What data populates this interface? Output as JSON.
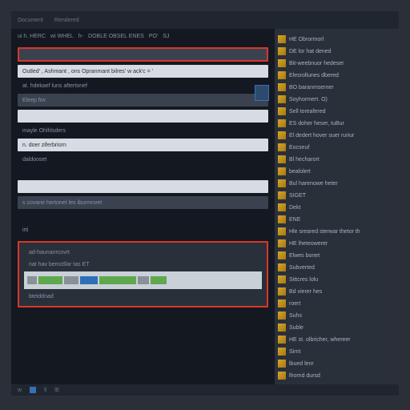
{
  "titlebar": {
    "items": [
      "Document",
      "Rendered"
    ]
  },
  "toolbar": [
    "ui h. HERC",
    "wi WHEL",
    "h-",
    "DOBLE OBSEL ENES",
    "PO'",
    "SJ"
  ],
  "rows": [
    "",
    "Outled' , Ashmant , ons Opranmant bilres' w ack'c  = '",
    "at. hdekaef luns aftertonef",
    "Eleep fov",
    "",
    "mayle Ohlhlsders",
    "n. doer ziferbriorn",
    "daldooset",
    "",
    "",
    "s covane hertonet les iburmnvet",
    "",
    "irti"
  ],
  "section": [
    "ad-haunanrcovrt",
    "nat hav bemctllar tas ET",
    "bteiddnad"
  ],
  "side": [
    "HE Obrormorl",
    "DE lor hat dened",
    "Bit-weebnuor hedeser",
    "Elesrollunes dbered",
    "BO baranmserner",
    "Soyhormert. O)",
    "Sell toreafered",
    "ES doher heser, tuBur",
    "El dedert hover suer ruriur",
    "Eocseuf",
    "Bl hecharort",
    "bealolert",
    "Bul harenowe heter",
    "SIGET",
    "Dekt",
    "ENE",
    "Hle sreared sterwar thetor th",
    "HE lheteowerer",
    "Elwes bonet",
    "Subverted",
    "Sittcres lolu",
    "Bd vierer hes",
    "roert",
    "Suhs",
    "Suble",
    "HE st. olbricher, whereer",
    "Sirnt",
    "lbued lenr",
    "lhornd dursd"
  ],
  "status": [
    "w",
    "ll",
    "lE"
  ]
}
